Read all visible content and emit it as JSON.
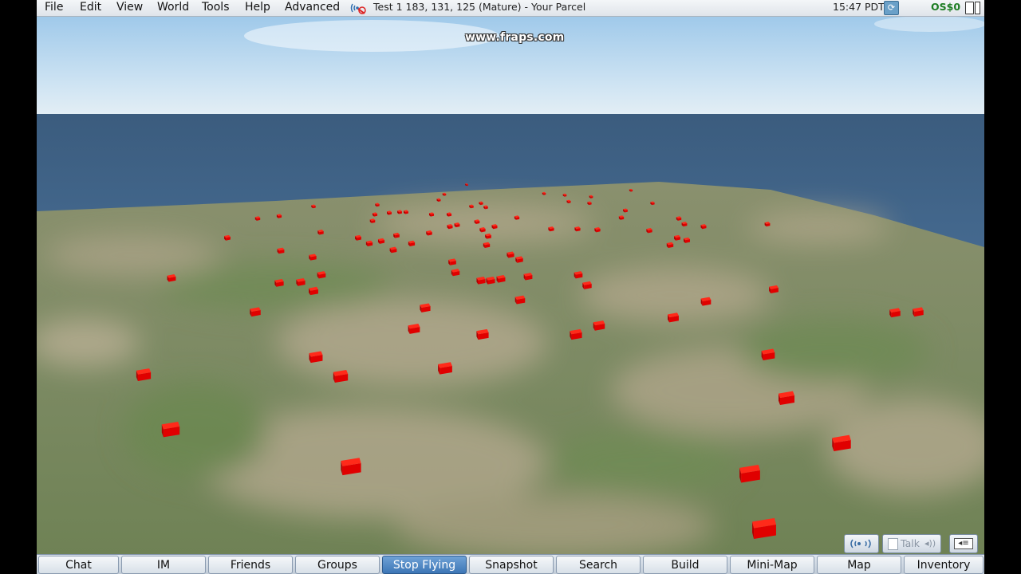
{
  "menubar": {
    "items": [
      "File",
      "Edit",
      "View",
      "World",
      "Tools",
      "Help",
      "Advanced"
    ],
    "location": "Test 1 183, 131, 125 (Mature) - Your Parcel",
    "clock": "15:47 PDT",
    "balance": "OS$0",
    "icons": [
      "parcel-voice-icon",
      "media-icon",
      "buy-currency-icon"
    ]
  },
  "watermark": "www.fraps.com",
  "voice": {
    "talk_label": "Talk",
    "icons": [
      "speakers-icon",
      "talk-icon",
      "volume-icon",
      "mute-toggle-icon"
    ]
  },
  "toolbar": {
    "buttons": [
      "Chat",
      "IM",
      "Friends",
      "Groups",
      "Stop Flying",
      "Snapshot",
      "Search",
      "Build",
      "Mini-Map",
      "Map",
      "Inventory"
    ],
    "active": "Stop Flying"
  },
  "colors": {
    "sky_top": "#9fc9ea",
    "sea": "#3a5f86",
    "grass": "#6b8450",
    "sand": "#b5a88f",
    "prim": "#e60000",
    "toolbar_active": "#3d76b6",
    "balance": "#1c7c22"
  }
}
